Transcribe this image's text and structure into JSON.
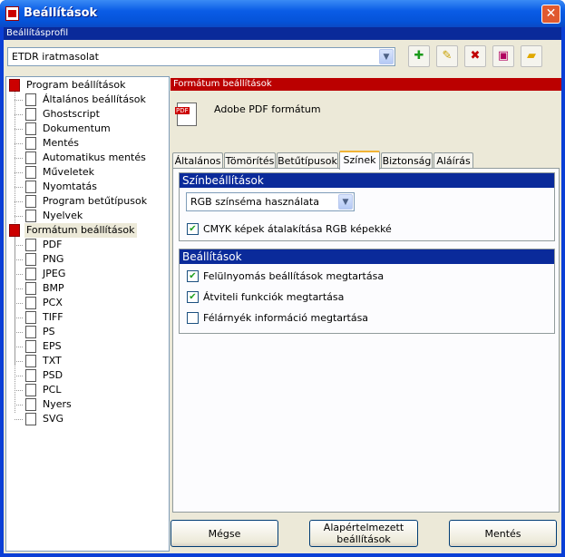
{
  "window": {
    "title": "Beállítások",
    "close_glyph": "✕"
  },
  "profile": {
    "header": "Beállításprofil",
    "selected": "ETDR iratmasolat",
    "toolbar": [
      {
        "name": "add-profile",
        "glyph": "✚",
        "color": "#1a9a1a"
      },
      {
        "name": "rename-profile",
        "glyph": "✎",
        "color": "#c8a000"
      },
      {
        "name": "delete-profile",
        "glyph": "✖",
        "color": "#c00000"
      },
      {
        "name": "save-profile",
        "glyph": "▣",
        "color": "#b00060"
      },
      {
        "name": "open-profile",
        "glyph": "▰",
        "color": "#e0a800"
      }
    ]
  },
  "tree": {
    "program": "Program beállítások",
    "items": [
      "Általános beállítások",
      "Ghostscript",
      "Dokumentum",
      "Mentés",
      "Automatikus mentés",
      "Műveletek",
      "Nyomtatás",
      "Program betűtípusok",
      "Nyelvek"
    ],
    "formats": "Formátum beállítások",
    "format_items": [
      "PDF",
      "PNG",
      "JPEG",
      "BMP",
      "PCX",
      "TIFF",
      "PS",
      "EPS",
      "TXT",
      "PSD",
      "PCL",
      "Nyers",
      "SVG"
    ]
  },
  "format_panel": {
    "header": "Formátum beállítások",
    "name": "Adobe PDF formátum"
  },
  "tabs": [
    "Általános",
    "Tömörítés",
    "Betűtípusok",
    "Színek",
    "Biztonság",
    "Aláírás"
  ],
  "active_tab": "Színek",
  "color_group": {
    "title": "Színbeállítások",
    "scheme": "RGB színséma használata",
    "cmyk_to_rgb": {
      "label": "CMYK képek átalakítása RGB képekké",
      "checked": true
    }
  },
  "settings_group": {
    "title": "Beállítások",
    "options": [
      {
        "label": "Felülnyomás beállítások megtartása",
        "checked": true
      },
      {
        "label": "Átviteli funkciók megtartása",
        "checked": true
      },
      {
        "label": "Félárnyék információ megtartása",
        "checked": false
      }
    ]
  },
  "buttons": {
    "cancel": "Mégse",
    "defaults": "Alapértelmezett beállítások",
    "save": "Mentés"
  }
}
